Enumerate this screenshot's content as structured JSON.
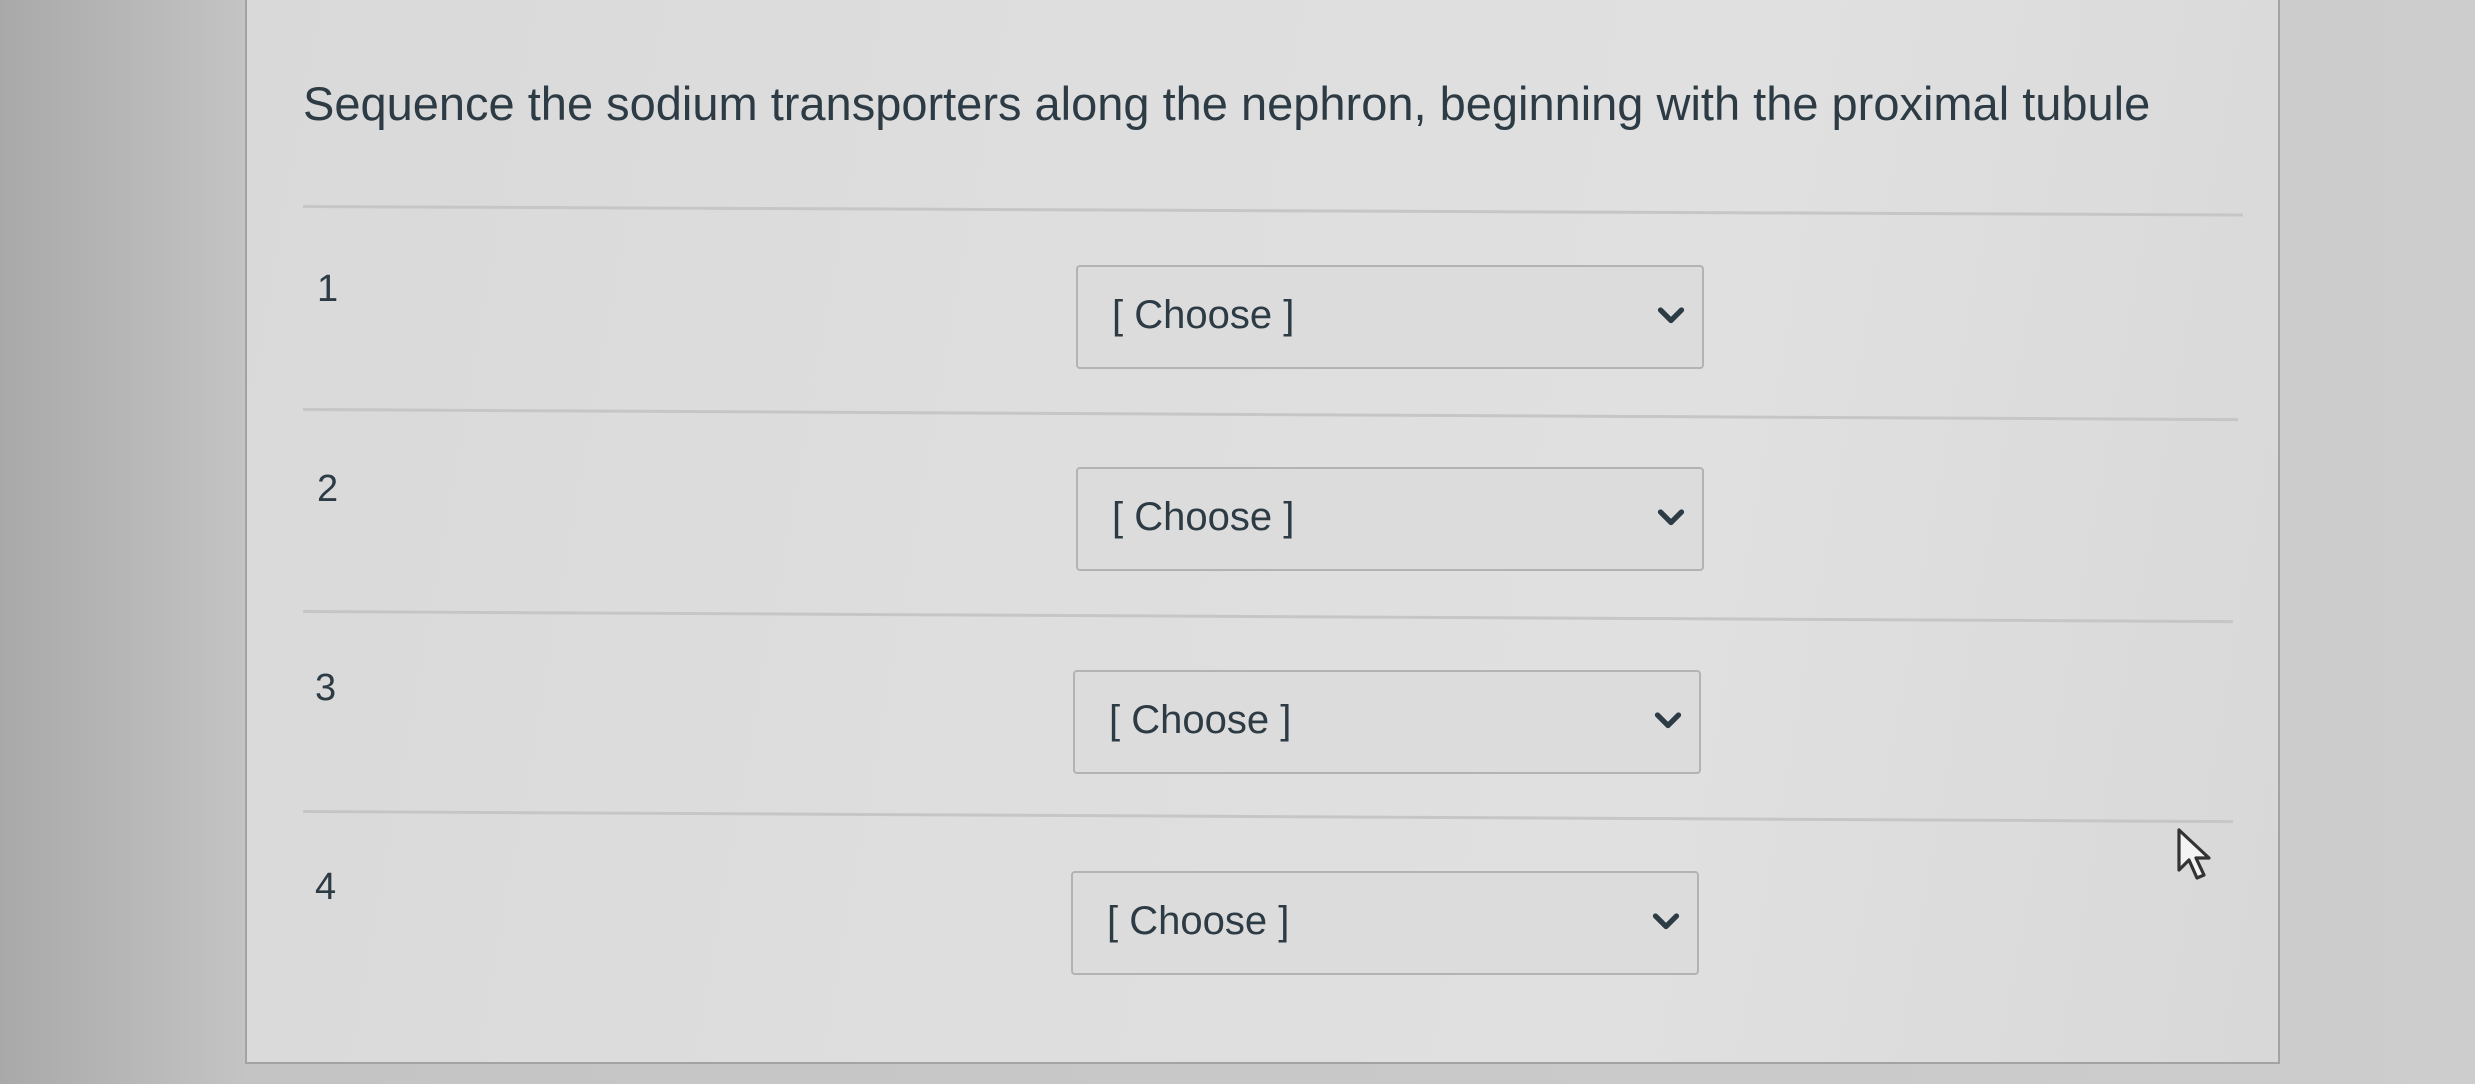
{
  "question": {
    "text": "Sequence the sodium transporters along the nephron, beginning with the proximal tubule"
  },
  "rows": [
    {
      "number": "1",
      "select": {
        "value": "[ Choose ]",
        "icon": "chevron-down-icon"
      }
    },
    {
      "number": "2",
      "select": {
        "value": "[ Choose ]",
        "icon": "chevron-down-icon"
      }
    },
    {
      "number": "3",
      "select": {
        "value": "[ Choose ]",
        "icon": "chevron-down-icon"
      }
    },
    {
      "number": "4",
      "select": {
        "value": "[ Choose ]",
        "icon": "chevron-down-icon"
      }
    }
  ],
  "cursor": {
    "icon": "mouse-pointer-icon"
  },
  "colors": {
    "text": "#2d3b45",
    "divider": "#c6c6c6",
    "select_border": "#b3b3b3"
  }
}
